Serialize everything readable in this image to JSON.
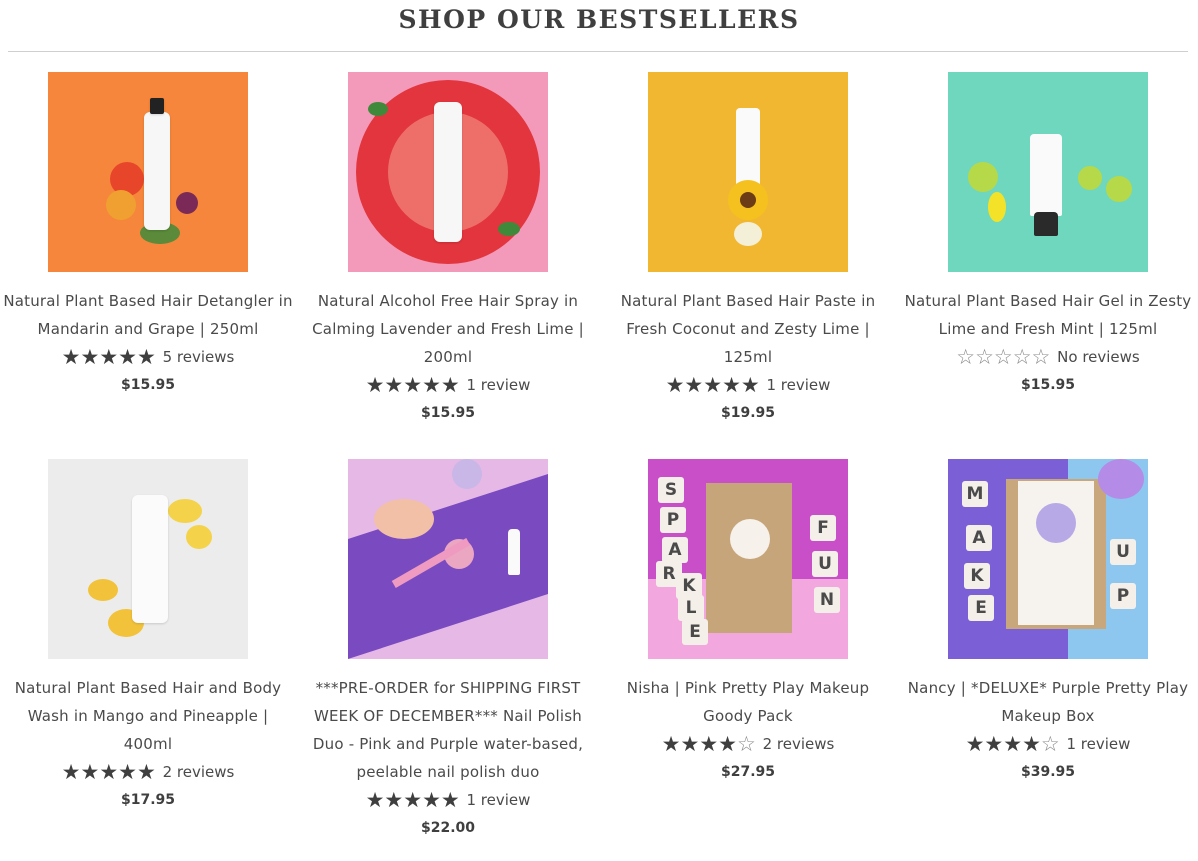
{
  "section_title": "SHOP OUR BESTSELLERS",
  "products": [
    {
      "title": "Natural Plant Based Hair Detangler in Mandarin and Grape | 250ml",
      "rating": 5,
      "reviews": "5 reviews",
      "price": "$15.95",
      "image_bg": "#f5863b"
    },
    {
      "title": "Natural Alcohol Free Hair Spray in Calming Lavender and Fresh Lime | 200ml",
      "rating": 5,
      "reviews": "1 review",
      "price": "$15.95",
      "image_bg": "#f39abb"
    },
    {
      "title": "Natural Plant Based Hair Paste in Fresh Coconut and Zesty Lime | 125ml",
      "rating": 5,
      "reviews": "1 review",
      "price": "$19.95",
      "image_bg": "#f2b731"
    },
    {
      "title": "Natural Plant Based Hair Gel in Zesty Lime and Fresh Mint | 125ml",
      "rating": 0,
      "reviews": "No reviews",
      "price": "$15.95",
      "image_bg": "#6fd7bd"
    },
    {
      "title": "Natural Plant Based Hair and Body Wash in Mango and Pineapple | 400ml",
      "rating": 5,
      "reviews": "2 reviews",
      "price": "$17.95",
      "image_bg": "#ececec"
    },
    {
      "title": "***PRE-ORDER for SHIPPING FIRST WEEK OF DECEMBER*** Nail Polish Duo - Pink and Purple water-based, peelable nail polish duo",
      "rating": 5,
      "reviews": "1 review",
      "price": "$22.00",
      "image_bg": "#d98fd8"
    },
    {
      "title": "Nisha | Pink Pretty Play Makeup Goody Pack",
      "rating": 4,
      "reviews": "2 reviews",
      "price": "$27.95",
      "image_bg": "#c84fc7"
    },
    {
      "title": "Nancy | *DELUXE* Purple Pretty Play Makeup Box",
      "rating": 4,
      "reviews": "1 review",
      "price": "$39.95",
      "image_bg": "#7b5fd6"
    }
  ],
  "image_text": {
    "sparkle_letters": [
      "S",
      "P",
      "A",
      "R",
      "K",
      "L",
      "E"
    ],
    "fun_letters": [
      "F",
      "U",
      "N"
    ],
    "make_letters": [
      "M",
      "A",
      "K",
      "E"
    ],
    "up_letters": [
      "U",
      "P"
    ]
  }
}
